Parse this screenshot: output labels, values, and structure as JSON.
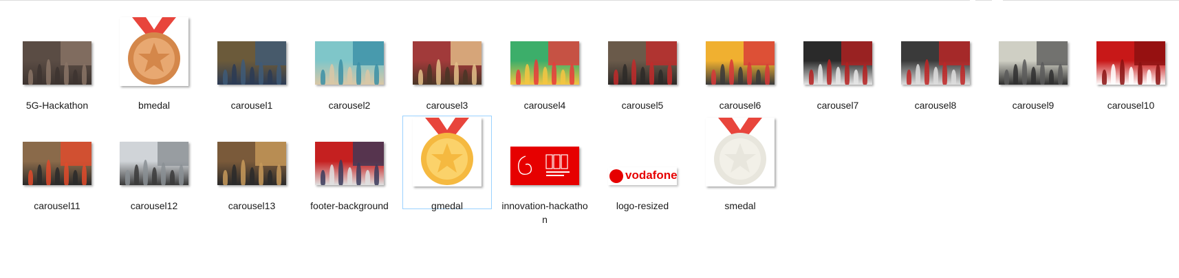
{
  "files": [
    {
      "name": "5G-Hackathon",
      "kind": "photo-dark"
    },
    {
      "name": "bmedal",
      "kind": "medal",
      "medal_color": "#d4874a",
      "medal_inner": "#e8a871"
    },
    {
      "name": "carousel1",
      "kind": "photo-crowd"
    },
    {
      "name": "carousel2",
      "kind": "photo-teal"
    },
    {
      "name": "carousel3",
      "kind": "photo-stage"
    },
    {
      "name": "carousel4",
      "kind": "photo-colorful"
    },
    {
      "name": "carousel5",
      "kind": "photo-red-floor"
    },
    {
      "name": "carousel6",
      "kind": "photo-colorful2"
    },
    {
      "name": "carousel7",
      "kind": "photo-red-wall"
    },
    {
      "name": "carousel8",
      "kind": "photo-red-wall2"
    },
    {
      "name": "carousel9",
      "kind": "photo-group"
    },
    {
      "name": "carousel10",
      "kind": "photo-red"
    },
    {
      "name": "carousel11",
      "kind": "photo-bags"
    },
    {
      "name": "carousel12",
      "kind": "photo-office"
    },
    {
      "name": "carousel13",
      "kind": "photo-hall"
    },
    {
      "name": "footer-background",
      "kind": "photo-panel"
    },
    {
      "name": "gmedal",
      "kind": "medal",
      "medal_color": "#f5b940",
      "medal_inner": "#fbd26a"
    },
    {
      "name": "innovation-hackathon",
      "kind": "red-banner"
    },
    {
      "name": "logo-resized",
      "kind": "vodafone-logo",
      "logo_text": "vodafone"
    },
    {
      "name": "smedal",
      "kind": "medal",
      "medal_color": "#e8e6dd",
      "medal_inner": "#f2f0e8"
    }
  ],
  "selected": "gmedal",
  "colors": {
    "ribbon": "#e8453c",
    "vodafone_red": "#e60000",
    "selection_border": "#99d1ff"
  }
}
